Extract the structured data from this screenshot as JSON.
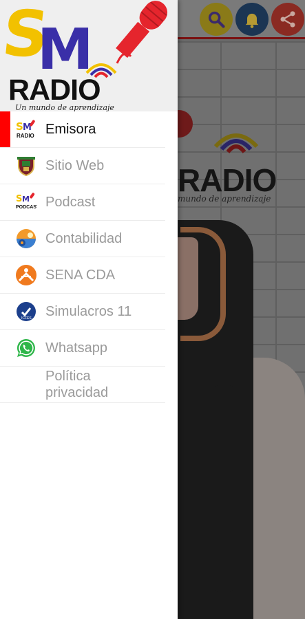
{
  "drawer": {
    "logo": {
      "letters": "SM",
      "word": "RADIO",
      "tagline": "Un mundo de aprendizaje"
    },
    "items": [
      {
        "label": "Emisora",
        "icon": "smradio-logo-icon",
        "active": true
      },
      {
        "label": "Sitio Web",
        "icon": "school-shield-icon",
        "active": false
      },
      {
        "label": "Podcast",
        "icon": "podcast-logo-icon",
        "active": false
      },
      {
        "label": "Contabilidad",
        "icon": "accounting-gear-icon",
        "active": false
      },
      {
        "label": "SENA CDA",
        "icon": "sena-logo-icon",
        "active": false
      },
      {
        "label": "Simulacros 11",
        "icon": "simulacros-badge-icon",
        "active": false
      },
      {
        "label": "Whatsapp",
        "icon": "whatsapp-icon",
        "active": false
      },
      {
        "label": "Política privacidad",
        "icon": "",
        "active": false
      }
    ]
  },
  "background": {
    "logo_word": "RADIO",
    "logo_tagline": "mundo de aprendizaje"
  },
  "toolbar": {
    "buttons": [
      "search-icon",
      "bell-icon",
      "share-icon"
    ]
  },
  "colors": {
    "active_indicator": "#ff0000",
    "logo_yellow": "#f2c100",
    "logo_blue": "#3a2fa8",
    "search_button": "#f6c900",
    "bell_button": "#1e5a9c",
    "share_button": "#e0473a"
  }
}
